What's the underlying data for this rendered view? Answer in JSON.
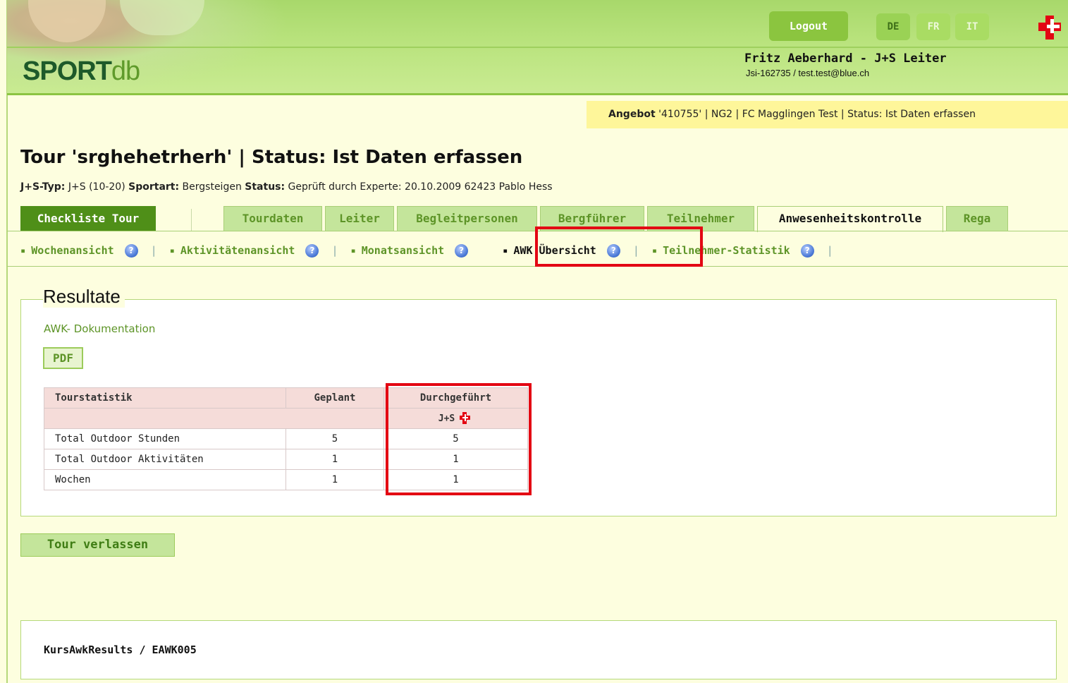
{
  "header": {
    "logo_sport": "SPORT",
    "logo_db": "db",
    "logout_label": "Logout",
    "languages": [
      "DE",
      "FR",
      "IT"
    ],
    "active_language": "DE",
    "user_name": "Fritz Aeberhard - J+S Leiter",
    "user_sub": "Jsi-162735 / test.test@blue.ch",
    "colors": {
      "green": "#8bc53f",
      "brand_red": "#e30613"
    }
  },
  "angebot": {
    "label": "Angebot",
    "rest": " '410755' | NG2 | FC Magglingen Test | Status: Ist Daten erfassen"
  },
  "page": {
    "title": "Tour 'srghehetrherh' | Status: Ist Daten erfassen",
    "meta": {
      "jstyp_label": "J+S-Typ:",
      "jstyp_value": " J+S (10-20) ",
      "sportart_label": "Sportart:",
      "sportart_value": " Bergsteigen ",
      "status_label": "Status:",
      "status_value": " Geprüft durch Experte: 20.10.2009 62423 Pablo Hess"
    }
  },
  "tabs": {
    "checkliste": "Checkliste Tour",
    "items": [
      "Tourdaten",
      "Leiter",
      "Begleitpersonen",
      "Bergführer",
      "Teilnehmer",
      "Anwesenheitskontrolle",
      "Rega"
    ],
    "active": "Anwesenheitskontrolle"
  },
  "subnav": {
    "items": [
      "Wochenansicht",
      "Aktivitätenansicht",
      "Monatsansicht",
      "AWK Übersicht",
      "Teilnehmer-Statistik"
    ],
    "active": "AWK Übersicht",
    "bullet": "▪",
    "separator": "|",
    "help": "?"
  },
  "results": {
    "legend": "Resultate",
    "doc_link": "AWK- Dokumentation",
    "pdf_label": "PDF",
    "table": {
      "headers": [
        "Tourstatistik",
        "Geplant",
        "Durchgeführt"
      ],
      "subheader": "J+S",
      "rows": [
        [
          "Total Outdoor Stunden",
          "5",
          "5"
        ],
        [
          "Total Outdoor Aktivitäten",
          "1",
          "1"
        ],
        [
          "Wochen",
          "1",
          "1"
        ]
      ]
    }
  },
  "leave_label": "Tour verlassen",
  "footer": "KursAwkResults / EAWK005"
}
